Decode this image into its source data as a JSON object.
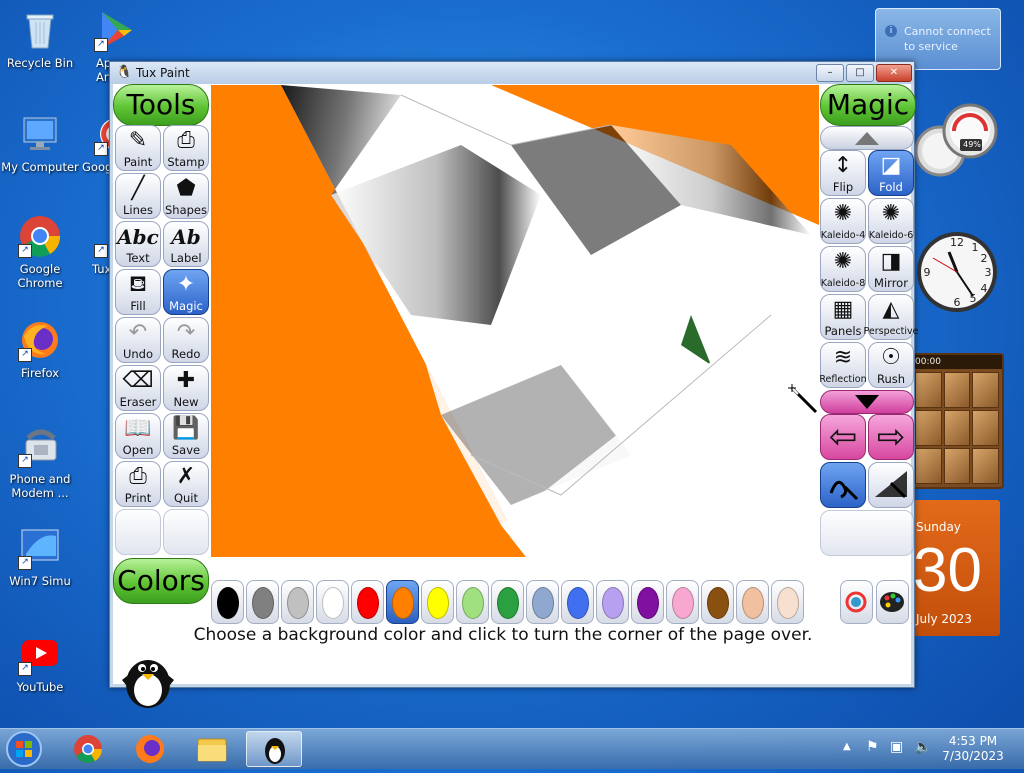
{
  "desktop": {
    "icons": [
      {
        "label": "Recycle Bin"
      },
      {
        "label": "Ap\nAnd"
      },
      {
        "label": "My Computer"
      },
      {
        "label": "Goog"
      },
      {
        "label": "Google\nChrome"
      },
      {
        "label": "Tux"
      },
      {
        "label": "Firefox"
      },
      {
        "label": "Phone and\nModem ..."
      },
      {
        "label": "Win7 Simu"
      },
      {
        "label": "YouTube"
      }
    ]
  },
  "notification": {
    "text": "Cannot connect to service"
  },
  "gadgets": {
    "gauge_percent": "49%",
    "puzzle_timer": "00:00",
    "calendar": {
      "day": "Sunday",
      "date": "30",
      "month_year": "July 2023"
    }
  },
  "window": {
    "title": "Tux Paint",
    "minimize": "–",
    "maximize": "□",
    "close": "✕"
  },
  "tools": {
    "header": "Tools",
    "buttons": [
      {
        "label": "Paint",
        "icon": "✎"
      },
      {
        "label": "Stamp",
        "icon": "⎙"
      },
      {
        "label": "Lines",
        "icon": "╱"
      },
      {
        "label": "Shapes",
        "icon": "⬟"
      },
      {
        "label": "Text",
        "icon": "Abc"
      },
      {
        "label": "Label",
        "icon": "Ab"
      },
      {
        "label": "Fill",
        "icon": "⛾"
      },
      {
        "label": "Magic",
        "icon": "✦"
      },
      {
        "label": "Undo",
        "icon": "↶"
      },
      {
        "label": "Redo",
        "icon": "↷"
      },
      {
        "label": "Eraser",
        "icon": "⌫"
      },
      {
        "label": "New",
        "icon": "✚"
      },
      {
        "label": "Open",
        "icon": "📖"
      },
      {
        "label": "Save",
        "icon": "💾"
      },
      {
        "label": "Print",
        "icon": "⎙"
      },
      {
        "label": "Quit",
        "icon": "✗"
      }
    ]
  },
  "magic": {
    "header": "Magic",
    "buttons": [
      {
        "label": "Flip",
        "icon": "↕"
      },
      {
        "label": "Fold",
        "icon": "◪"
      },
      {
        "label": "Kaleido-4",
        "icon": "✺"
      },
      {
        "label": "Kaleido-6",
        "icon": "✺"
      },
      {
        "label": "Kaleido-8",
        "icon": "✺"
      },
      {
        "label": "Mirror",
        "icon": "◨"
      },
      {
        "label": "Panels",
        "icon": "▦"
      },
      {
        "label": "Perspective",
        "icon": "◭"
      },
      {
        "label": "Reflection",
        "icon": "≋"
      },
      {
        "label": "Rush",
        "icon": "☉"
      }
    ],
    "nav_left": "⇦",
    "nav_right": "⇨"
  },
  "colors": {
    "header": "Colors",
    "swatches": [
      "#000000",
      "#808080",
      "#c0c0c0",
      "#ffffff",
      "#ff0000",
      "#ff8000",
      "#ffff00",
      "#a0e080",
      "#2aa040",
      "#90a8d0",
      "#4070f0",
      "#b8a0f0",
      "#8010a0",
      "#f8a8d0",
      "#8a5010",
      "#f0c0a0",
      "#f8e0d0"
    ],
    "selected_index": 5
  },
  "instruction": "Choose a background color and click to turn the corner of the page over.",
  "taskbar": {
    "time": "4:53 PM",
    "date": "7/30/2023"
  }
}
